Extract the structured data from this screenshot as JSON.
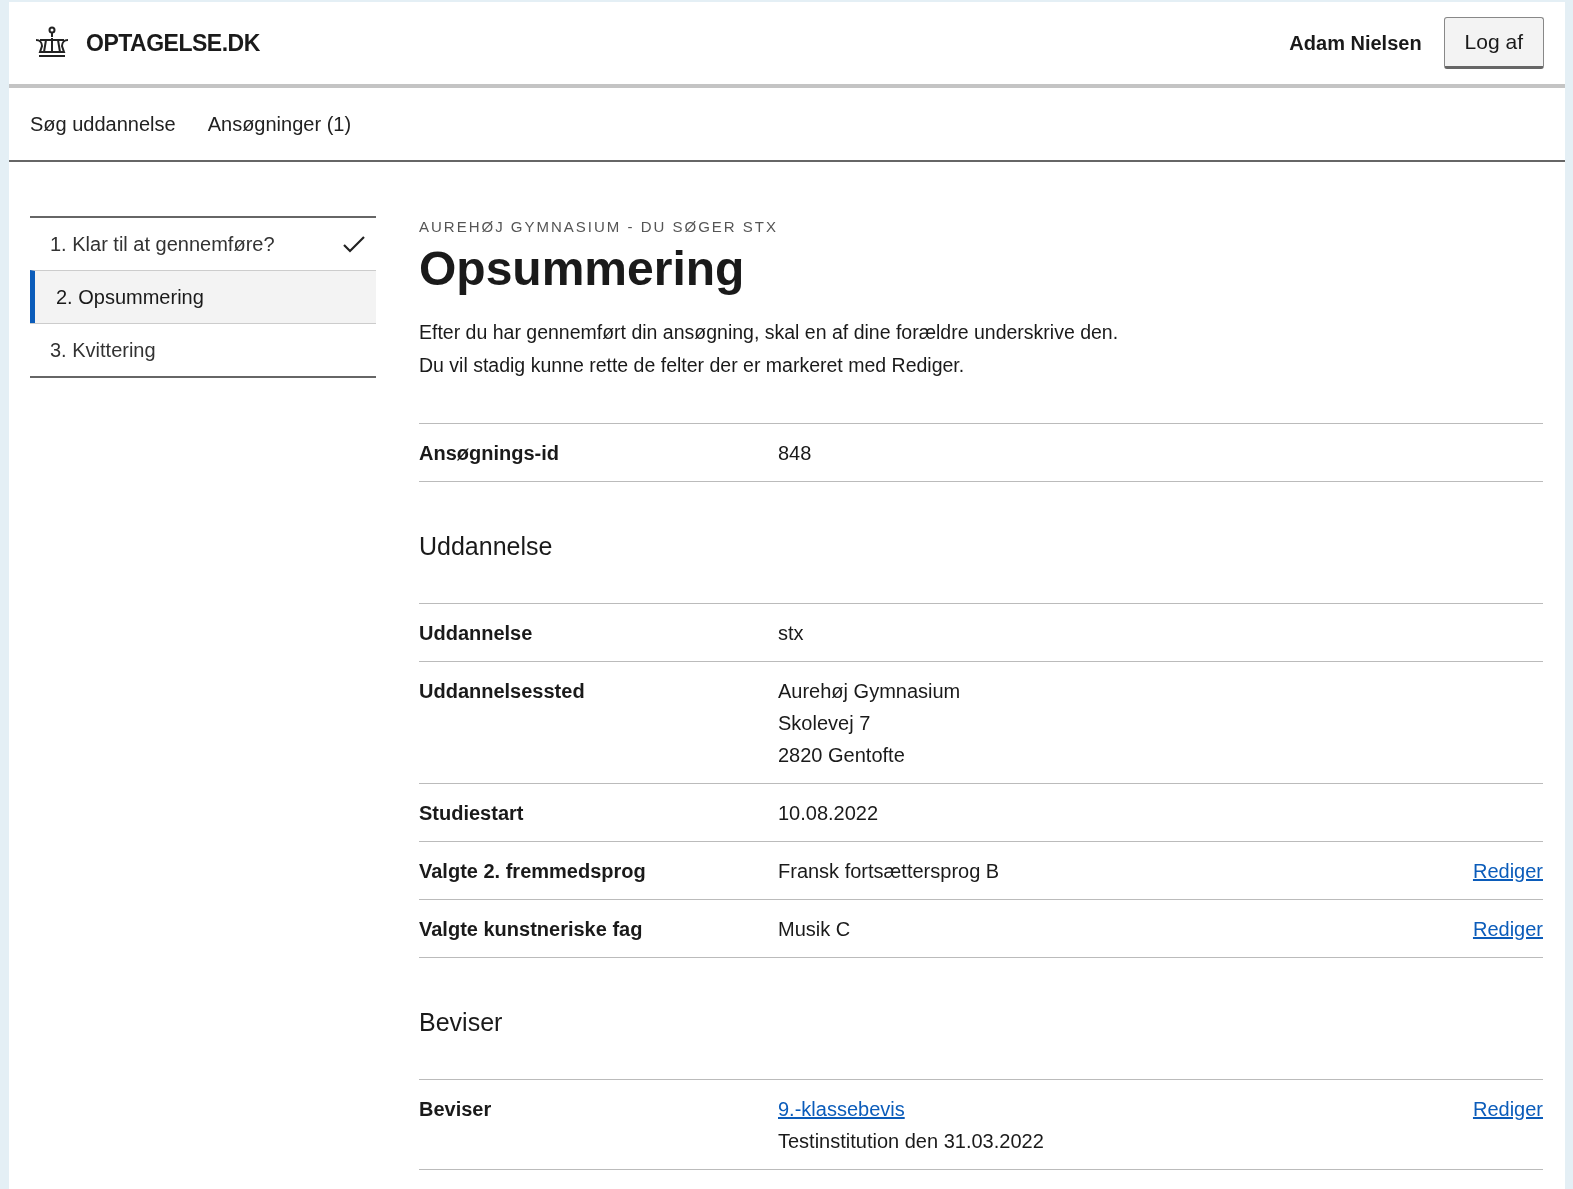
{
  "header": {
    "logo_text": "OPTAGELSE.DK",
    "user_name": "Adam Nielsen",
    "logout_button": "Log af"
  },
  "nav": [
    "Søg uddannelse",
    "Ansøgninger (1)"
  ],
  "steps": [
    {
      "label": "1. Klar til at gennemføre?",
      "completed": true,
      "selected": false
    },
    {
      "label": "2. Opsummering",
      "completed": false,
      "selected": true
    },
    {
      "label": "3. Kvittering",
      "completed": false,
      "selected": false
    }
  ],
  "main": {
    "eyebrow": "AUREHØJ GYMNASIUM - DU SØGER STX",
    "title": "Opsummering",
    "intro": [
      "Efter du har gennemført din ansøgning, skal en af dine forældre underskrive den.",
      "Du vil stadig kunne rette de felter der er markeret med Rediger."
    ],
    "sections": [
      {
        "rows": [
          {
            "label": "Ansøgnings-id",
            "values": [
              {
                "kind": "text",
                "text": "848"
              }
            ]
          }
        ]
      },
      {
        "heading": "Uddannelse",
        "rows": [
          {
            "label": "Uddannelse",
            "values": [
              {
                "kind": "text",
                "text": "stx"
              }
            ]
          },
          {
            "label": "Uddannelsessted",
            "values": [
              {
                "kind": "text",
                "text": "Aurehøj Gymnasium"
              },
              {
                "kind": "text",
                "text": "Skolevej 7"
              },
              {
                "kind": "text",
                "text": "2820 Gentofte"
              }
            ]
          },
          {
            "label": "Studiestart",
            "values": [
              {
                "kind": "text",
                "text": "10.08.2022"
              }
            ]
          },
          {
            "label": "Valgte 2. fremmedsprog",
            "values": [
              {
                "kind": "text",
                "text": "Fransk fortsættersprog B"
              }
            ],
            "edit_link": "Rediger"
          },
          {
            "label": "Valgte kunstneriske fag",
            "values": [
              {
                "kind": "text",
                "text": "Musik C"
              }
            ],
            "edit_link": "Rediger"
          }
        ]
      },
      {
        "heading": "Beviser",
        "rows": [
          {
            "label": "Beviser",
            "values": [
              {
                "kind": "link",
                "text": "9.-klassebevis"
              },
              {
                "kind": "text",
                "text": "Testinstitution den 31.03.2022"
              }
            ],
            "edit_link": "Rediger"
          }
        ]
      }
    ]
  }
}
